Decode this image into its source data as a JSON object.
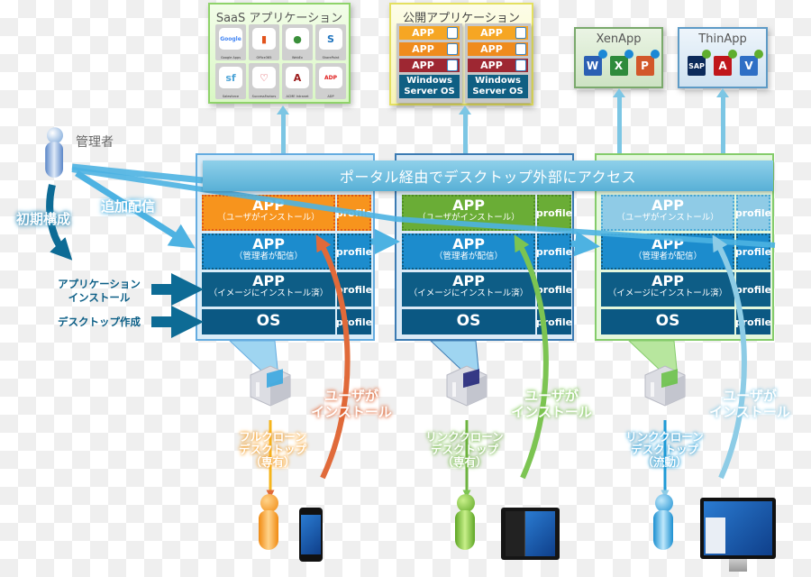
{
  "saas_panel": {
    "title": "SaaS アプリケーション",
    "apps": [
      {
        "name": "Google Apps",
        "icon": "google-icon",
        "glyph": "Google",
        "color": "#4285f4"
      },
      {
        "name": "Office365",
        "icon": "office365-icon",
        "glyph": "▮",
        "color": "#e2531c"
      },
      {
        "name": "WebEx",
        "icon": "webex-icon",
        "glyph": "●",
        "color": "#3a8f3a"
      },
      {
        "name": "SharePoint",
        "icon": "sharepoint-icon",
        "glyph": "S",
        "color": "#1e73be"
      },
      {
        "name": "Salesforce",
        "icon": "salesforce-icon",
        "glyph": "sf",
        "color": "#4fa5d8"
      },
      {
        "name": "SuccessFactors",
        "icon": "successfactors-icon",
        "glyph": "♡",
        "color": "#d9363e"
      },
      {
        "name": "ACME Intranet",
        "icon": "acme-icon",
        "glyph": "A",
        "color": "#9c1b1b"
      },
      {
        "name": "ADP",
        "icon": "adp-icon",
        "glyph": "ADP",
        "color": "#e02020"
      }
    ]
  },
  "public_panel": {
    "title": "公開アプリケーション",
    "columns": [
      {
        "apps": [
          {
            "label": "APP",
            "color": "#f6a623",
            "icon": "outlook-icon"
          },
          {
            "label": "APP",
            "color": "#ef8b1d",
            "icon": "powerpoint-icon"
          },
          {
            "label": "APP",
            "color": "#9e2732",
            "icon": "internet-explorer-icon"
          }
        ],
        "os": [
          "Windows",
          "Server OS"
        ]
      },
      {
        "apps": [
          {
            "label": "APP",
            "color": "#f6a623",
            "icon": "outlook-icon"
          },
          {
            "label": "APP",
            "color": "#ef8b1d",
            "icon": "powerpoint-icon"
          },
          {
            "label": "APP",
            "color": "#9e2732",
            "icon": "internet-explorer-icon"
          }
        ],
        "os": [
          "Windows",
          "Server OS"
        ]
      }
    ]
  },
  "xenapp_panel": {
    "title": "XenApp",
    "apps": [
      {
        "icon": "word-icon",
        "glyph": "W",
        "color": "#2b5fb3"
      },
      {
        "icon": "excel-icon",
        "glyph": "X",
        "color": "#2e8b3c"
      },
      {
        "icon": "powerpoint-icon",
        "glyph": "P",
        "color": "#d2582a"
      }
    ]
  },
  "thinapp_panel": {
    "title": "ThinApp",
    "apps": [
      {
        "icon": "sap-icon",
        "glyph": "SAP",
        "color": "#0c2a5a"
      },
      {
        "icon": "acrobat-icon",
        "glyph": "A",
        "color": "#c0161b"
      },
      {
        "icon": "visio-icon",
        "glyph": "V",
        "color": "#2f6fc5"
      }
    ]
  },
  "portal_bar": "ポータル経由でデスクトップ外部にアクセス",
  "admin": {
    "label": "管理者"
  },
  "left_labels": {
    "initial_setup": "初期構成",
    "additional_delivery": "追加配信",
    "app_install": [
      "アプリケーション",
      "インストール"
    ],
    "desktop_create": "デスクトップ作成"
  },
  "columns": [
    {
      "layers": {
        "user_app": {
          "title": "APP",
          "sub": "（ユーザがインストール）"
        },
        "admin_app": {
          "title": "APP",
          "sub": "（管理者が配信）"
        },
        "image_app": {
          "title": "APP",
          "sub": "（イメージにインストール済）"
        },
        "os": {
          "title": "OS"
        }
      },
      "profile": "profile",
      "user_install": [
        "ユーザが",
        "インストール"
      ],
      "desktop_type": [
        "フルクローン",
        "デスクトップ",
        "（専有）"
      ],
      "device": "smartphone",
      "accent": "#f39a1f"
    },
    {
      "layers": {
        "user_app": {
          "title": "APP",
          "sub": "（ユーザがインストール）"
        },
        "admin_app": {
          "title": "APP",
          "sub": "（管理者が配信）"
        },
        "image_app": {
          "title": "APP",
          "sub": "（イメージにインストール済）"
        },
        "os": {
          "title": "OS"
        }
      },
      "profile": "profile",
      "user_install": [
        "ユーザが",
        "インストール"
      ],
      "desktop_type": [
        "リンククローン",
        "デスクトップ",
        "（専有）"
      ],
      "device": "tablet",
      "accent": "#6db33f"
    },
    {
      "layers": {
        "user_app": {
          "title": "APP",
          "sub": "（ユーザがインストール）"
        },
        "admin_app": {
          "title": "APP",
          "sub": "（管理者が配信）"
        },
        "image_app": {
          "title": "APP",
          "sub": "（イメージにインストール済）"
        },
        "os": {
          "title": "OS"
        }
      },
      "profile": "profile",
      "user_install": [
        "ユーザが",
        "インストール"
      ],
      "desktop_type": [
        "リンククローン",
        "デスクトップ",
        "（流動）"
      ],
      "device": "desktop-monitor",
      "accent": "#1e9ad6"
    }
  ],
  "colors": {
    "user_app_col1": "#f7941d",
    "user_app_col2": "#6aad36",
    "user_app_col3": "#8fcbe6",
    "admin_app": "#1c8ccd",
    "image_app": "#0e5d86",
    "os": "#0b5883",
    "arrow_light": "#4db2e2",
    "arrow_dark": "#0d6b95",
    "install_col1": "#e06a3a",
    "install_col2": "#7cc452",
    "install_col3": "#8dcce6"
  }
}
